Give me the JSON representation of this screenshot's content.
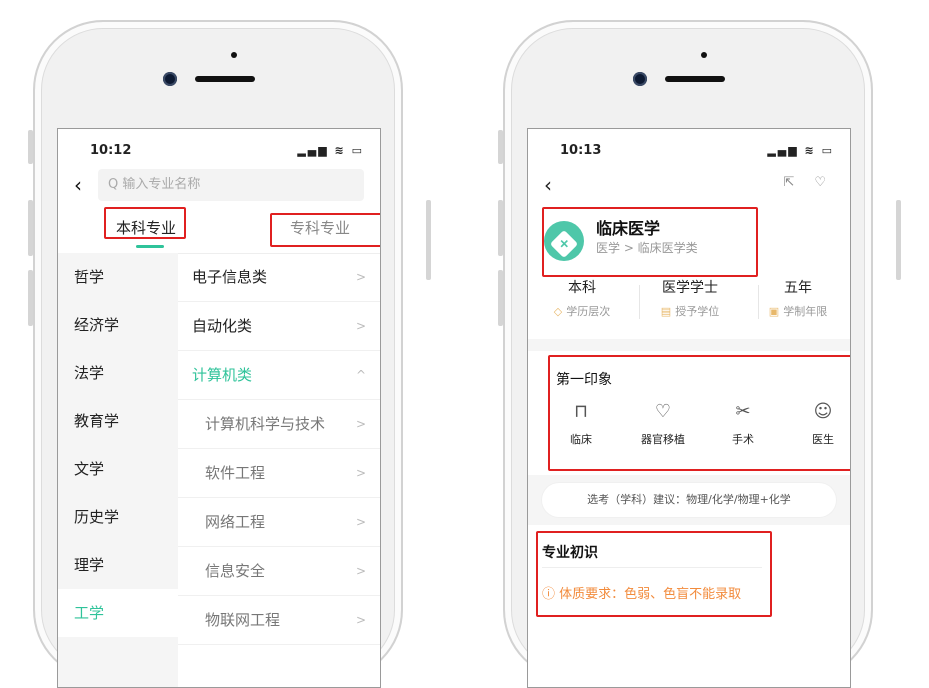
{
  "left": {
    "status_time": "10:12",
    "status_icons": "▂▄▆ ≋ ▭",
    "back_icon": "‹",
    "search_placeholder": "Q 输入专业名称",
    "tabs": [
      {
        "label": "本科专业"
      },
      {
        "label": "专科专业"
      }
    ],
    "categories": [
      {
        "label": "哲学"
      },
      {
        "label": "经济学"
      },
      {
        "label": "法学"
      },
      {
        "label": "教育学"
      },
      {
        "label": "文学"
      },
      {
        "label": "历史学"
      },
      {
        "label": "理学"
      },
      {
        "label": "工学"
      }
    ],
    "subcategories": [
      {
        "label": "电子信息类",
        "arrow": ">"
      },
      {
        "label": "自动化类",
        "arrow": ">"
      },
      {
        "label": "计算机类",
        "arrow": "^"
      },
      {
        "label": "计算机科学与技术",
        "arrow": ">"
      },
      {
        "label": "软件工程",
        "arrow": ">"
      },
      {
        "label": "网络工程",
        "arrow": ">"
      },
      {
        "label": "信息安全",
        "arrow": ">"
      },
      {
        "label": "物联网工程",
        "arrow": ">"
      }
    ]
  },
  "right": {
    "status_time": "10:13",
    "status_icons": "▂▄▆ ≋ ▭",
    "back_icon": "‹",
    "top_icons": "⇱ ♡",
    "major_title": "临床医学",
    "major_path": "医学 > 临床医学类",
    "stats": [
      {
        "value": "本科",
        "label": "学历层次",
        "icon": "◇"
      },
      {
        "value": "医学学士",
        "label": "授予学位",
        "icon": "▤"
      },
      {
        "value": "五年",
        "label": "学制年限",
        "icon": "▣"
      }
    ],
    "impression_title": "第一印象",
    "impressions": [
      {
        "label": "临床",
        "icon": "bed-icon",
        "glyph": "⊓"
      },
      {
        "label": "器官移植",
        "icon": "organ-transplant-icon",
        "glyph": "♡"
      },
      {
        "label": "手术",
        "icon": "surgery-scissors-icon",
        "glyph": "✂"
      },
      {
        "label": "医生",
        "icon": "doctor-icon",
        "glyph": "☺"
      }
    ],
    "advice": "选考（学科）建议：物理/化学/物理+化学",
    "section_title": "专业初识",
    "warning": "ⓘ 体质要求：色弱、色盲不能录取"
  },
  "colors": {
    "accent": "#2fc39a",
    "highlight_box": "#e02020",
    "warning": "#f28b3c"
  }
}
